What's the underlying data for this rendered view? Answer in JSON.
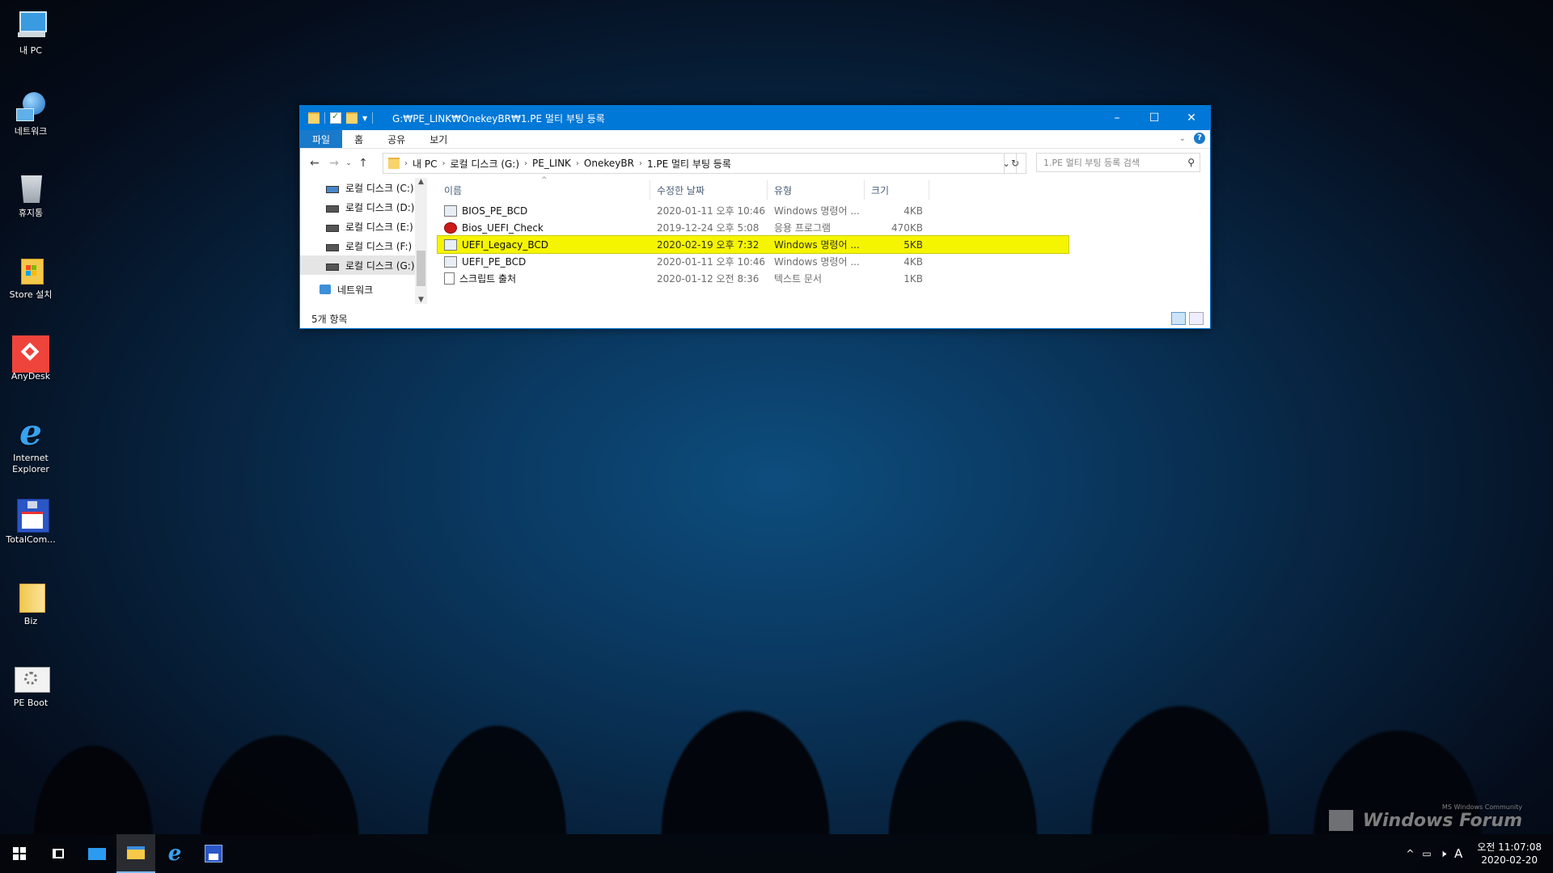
{
  "desktop": {
    "icons": [
      {
        "label": "내 PC",
        "icon": "computer-icon"
      },
      {
        "label": "네트워크",
        "icon": "network-icon"
      },
      {
        "label": "휴지통",
        "icon": "recycle-bin-icon"
      },
      {
        "label": "Store 설치",
        "icon": "store-installer-icon"
      },
      {
        "label": "AnyDesk",
        "icon": "anydesk-icon"
      },
      {
        "label": "Internet Explorer",
        "icon": "internet-explorer-icon"
      },
      {
        "label": "TotalCom...",
        "icon": "total-commander-icon"
      },
      {
        "label": "Biz",
        "icon": "folder-icon"
      },
      {
        "label": "PE Boot",
        "icon": "pe-boot-icon"
      }
    ],
    "watermark": {
      "text": "Windows Forum",
      "sub": "MS Windows Community"
    }
  },
  "window": {
    "title": "G:₩PE_LINK₩OnekeyBR₩1.PE 멀티 부팅 등록",
    "ribbon_tabs": [
      "파일",
      "홈",
      "공유",
      "보기"
    ],
    "breadcrumbs": [
      "내 PC",
      "로컬 디스크 (G:)",
      "PE_LINK",
      "OnekeyBR",
      "1.PE 멀티 부팅 등록"
    ],
    "search_placeholder": "1.PE 멀티 부팅 등록 검색",
    "nav_items": [
      {
        "label": "로컬 디스크 (C:)",
        "selected": false
      },
      {
        "label": "로컬 디스크 (D:)",
        "selected": false
      },
      {
        "label": "로컬 디스크 (E:)",
        "selected": false
      },
      {
        "label": "로컬 디스크 (F:)",
        "selected": false
      },
      {
        "label": "로컬 디스크 (G:)",
        "selected": true
      },
      {
        "label": "네트워크",
        "selected": false
      }
    ],
    "columns": [
      "이름",
      "수정한 날짜",
      "유형",
      "크기"
    ],
    "files": [
      {
        "name": "BIOS_PE_BCD",
        "date": "2020-01-11 오후 10:46",
        "type": "Windows 명령어 ...",
        "size": "4KB",
        "kind": "cmd",
        "highlight": false
      },
      {
        "name": "Bios_UEFI_Check",
        "date": "2019-12-24 오후 5:08",
        "type": "응용 프로그램",
        "size": "470KB",
        "kind": "exe",
        "highlight": false
      },
      {
        "name": "UEFI_Legacy_BCD",
        "date": "2020-02-19 오후 7:32",
        "type": "Windows 명령어 ...",
        "size": "5KB",
        "kind": "cmd",
        "highlight": true
      },
      {
        "name": "UEFI_PE_BCD",
        "date": "2020-01-11 오후 10:46",
        "type": "Windows 명령어 ...",
        "size": "4KB",
        "kind": "cmd",
        "highlight": false
      },
      {
        "name": "스크립트 출처",
        "date": "2020-01-12 오전 8:36",
        "type": "텍스트 문서",
        "size": "1KB",
        "kind": "txt",
        "highlight": false
      }
    ],
    "status": "5개 항목",
    "accent": "#0078d7",
    "highlight_color": "#f5f500"
  },
  "taskbar": {
    "ime": "A",
    "time": "오전 11:07:08",
    "date": "2020-02-20"
  }
}
